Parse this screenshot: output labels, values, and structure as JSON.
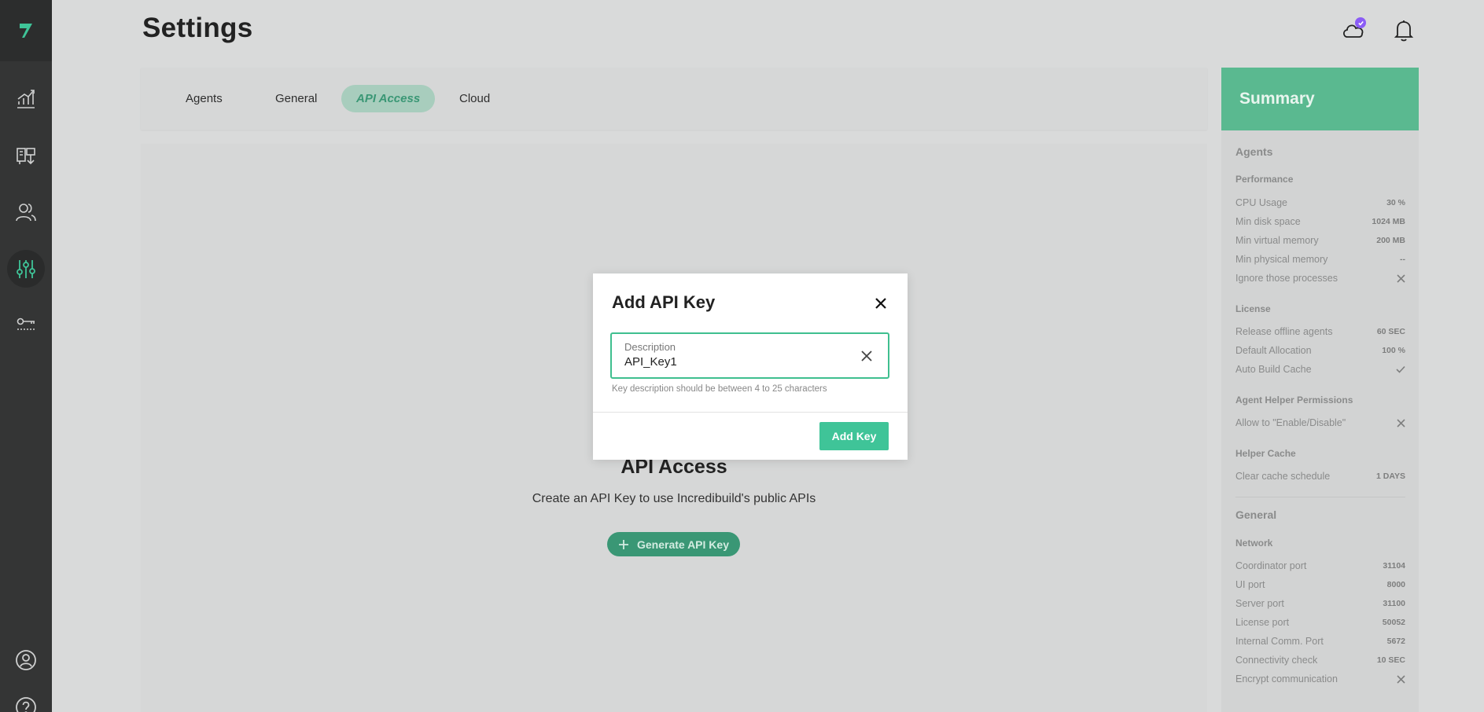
{
  "app": {
    "page_title": "Settings",
    "accent_color": "#3fc498"
  },
  "sidebar": {
    "items": [
      {
        "icon": "logo-icon"
      },
      {
        "icon": "chart-icon"
      },
      {
        "icon": "builds-icon"
      },
      {
        "icon": "users-icon"
      },
      {
        "icon": "settings-sliders-icon",
        "active": true
      },
      {
        "icon": "key-icon"
      },
      {
        "icon": "user-account-icon"
      },
      {
        "icon": "help-icon"
      }
    ]
  },
  "header": {
    "cloud_icon": "cloud-icon",
    "bell_icon": "bell-icon"
  },
  "tabs": [
    {
      "label": "Agents"
    },
    {
      "label": "General"
    },
    {
      "label": "API Access",
      "active": true
    },
    {
      "label": "Cloud"
    }
  ],
  "main": {
    "empty_title": "API Access",
    "empty_subtitle": "Create an API Key to use Incredibuild's public APIs",
    "generate_button": "Generate API Key"
  },
  "modal": {
    "title": "Add API Key",
    "field_label": "Description",
    "field_value": "API_Key1",
    "helper_text": "Key description should be between 4 to 25 characters",
    "submit_label": "Add Key"
  },
  "summary": {
    "title": "Summary",
    "sections": {
      "agents": "Agents",
      "general": "General"
    },
    "groups": {
      "performance": "Performance",
      "license": "License",
      "helper_permissions": "Agent Helper Permissions",
      "helper_cache": "Helper Cache",
      "network": "Network"
    },
    "rows": {
      "cpu_usage": {
        "label": "CPU Usage",
        "value": "30 %"
      },
      "min_disk": {
        "label": "Min disk space",
        "value": "1024 MB"
      },
      "min_virtual": {
        "label": "Min virtual memory",
        "value": "200 MB"
      },
      "min_physical": {
        "label": "Min physical memory",
        "value": "--"
      },
      "ignore_processes": {
        "label": "Ignore those processes",
        "value_icon": "x-icon"
      },
      "release_offline": {
        "label": "Release offline agents",
        "value": "60 SEC"
      },
      "default_allocation": {
        "label": "Default Allocation",
        "value": "100 %"
      },
      "auto_build_cache": {
        "label": "Auto Build Cache",
        "value_icon": "check-icon"
      },
      "allow_enable_disable": {
        "label": "Allow to \"Enable/Disable\"",
        "value_icon": "x-icon"
      },
      "clear_cache": {
        "label": "Clear cache schedule",
        "value": "1 DAYS"
      },
      "coordinator_port": {
        "label": "Coordinator port",
        "value": "31104"
      },
      "ui_port": {
        "label": "UI port",
        "value": "8000"
      },
      "server_port": {
        "label": "Server port",
        "value": "31100"
      },
      "license_port": {
        "label": "License port",
        "value": "50052"
      },
      "internal_comm_port": {
        "label": "Internal Comm. Port",
        "value": "5672"
      },
      "connectivity_check": {
        "label": "Connectivity check",
        "value": "10 SEC"
      },
      "encrypt_comm": {
        "label": "Encrypt communication",
        "value_icon": "x-icon"
      }
    }
  }
}
